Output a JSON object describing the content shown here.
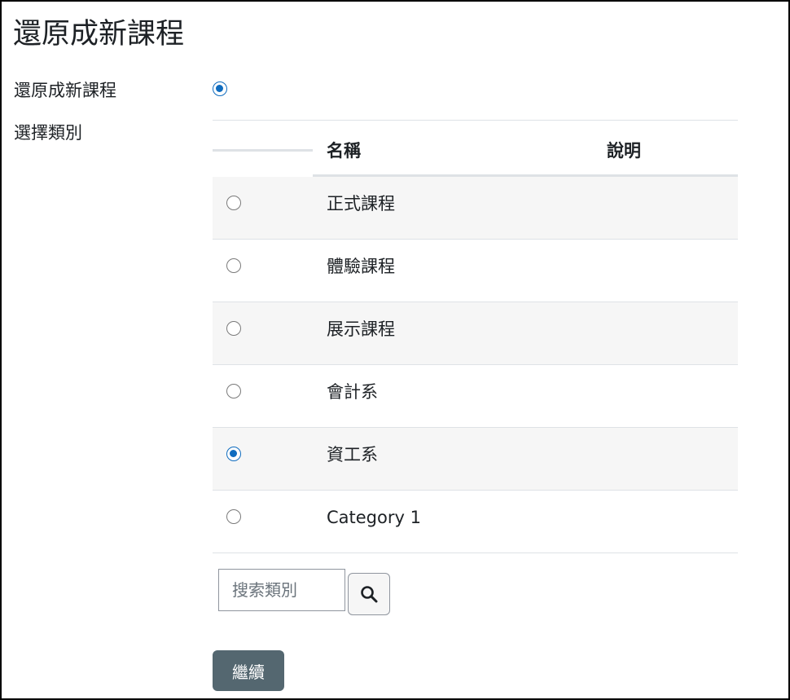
{
  "page": {
    "title": "還原成新課程"
  },
  "restore": {
    "label": "還原成新課程",
    "selected": true
  },
  "category": {
    "label": "選擇類別",
    "columns": {
      "name": "名稱",
      "description": "說明"
    },
    "rows": [
      {
        "name": "正式課程",
        "description": "",
        "selected": false
      },
      {
        "name": "體驗課程",
        "description": "",
        "selected": false
      },
      {
        "name": "展示課程",
        "description": "",
        "selected": false
      },
      {
        "name": "會計系",
        "description": "",
        "selected": false
      },
      {
        "name": "資工系",
        "description": "",
        "selected": true
      },
      {
        "name": "Category 1",
        "description": "",
        "selected": false
      }
    ]
  },
  "search": {
    "placeholder": "搜索類別",
    "value": "",
    "icon": "search-icon"
  },
  "actions": {
    "continue_label": "繼續"
  },
  "colors": {
    "accent": "#0f6cbf",
    "button": "#546770",
    "stripe": "#f6f6f6",
    "rule": "#dee2e6"
  }
}
